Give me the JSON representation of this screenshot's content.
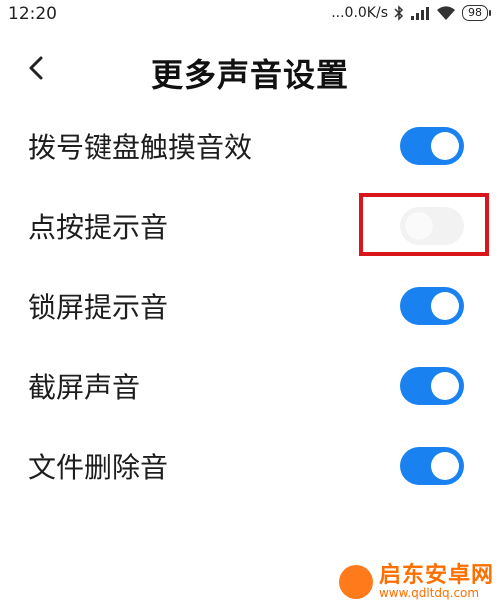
{
  "status_bar": {
    "time": "12:20",
    "network_speed": "...0.0K/s",
    "battery": "98",
    "icons": [
      "bluetooth-icon",
      "signal-icon",
      "wifi-icon",
      "battery-icon"
    ]
  },
  "header": {
    "back_icon": "chevron-left-icon",
    "title": "更多声音设置"
  },
  "settings": [
    {
      "label": "拨号键盘触摸音效",
      "enabled": true
    },
    {
      "label": "点按提示音",
      "enabled": false
    },
    {
      "label": "锁屏提示音",
      "enabled": true
    },
    {
      "label": "截屏声音",
      "enabled": true
    },
    {
      "label": "文件删除音",
      "enabled": true
    }
  ],
  "colors": {
    "toggle_on": "#1a82f0",
    "toggle_off": "#f2f2f2",
    "highlight": "#d9161c",
    "watermark": "#ff6f00"
  },
  "watermark": {
    "text": "启东安卓网",
    "url": "www.qdltdq.com"
  }
}
